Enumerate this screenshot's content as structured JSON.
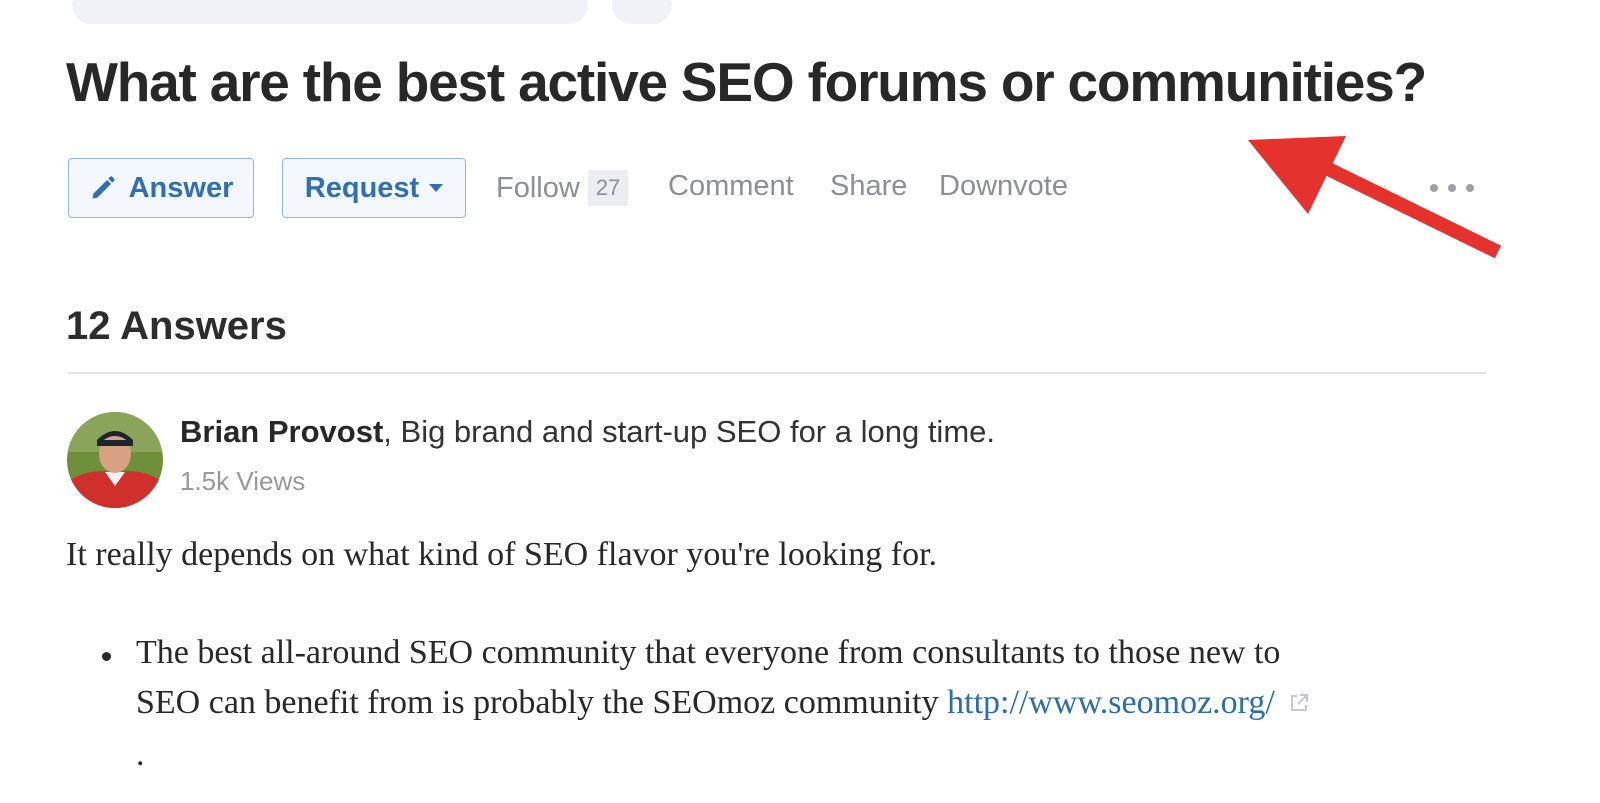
{
  "question": {
    "title": "What are the best active SEO forums or communities?"
  },
  "actions": {
    "answer_label": "Answer",
    "request_label": "Request",
    "follow_label": "Follow",
    "follow_count": "27",
    "comment_label": "Comment",
    "share_label": "Share",
    "downvote_label": "Downvote",
    "more_icon": "ellipsis-icon"
  },
  "annotation": {
    "arrow_color": "#e5322d"
  },
  "answers": {
    "heading": "12 Answers"
  },
  "answer": {
    "author_name": "Brian Provost",
    "author_sep": ", ",
    "author_credential": "Big brand and start-up SEO for a long time.",
    "views": "1.5k Views",
    "intro": "It really depends on what kind of SEO flavor you're looking for.",
    "bullet_line1": "The best all-around SEO community that everyone from consultants to those new to",
    "bullet_line2": "SEO can benefit from is probably the SEOmoz community ",
    "bullet_link": "http://www.seomoz.org/",
    "bullet_end": "."
  },
  "colors": {
    "accent_blue": "#2f6fb6",
    "link_blue": "#2b6dad",
    "muted_gray": "#8d8f94"
  }
}
